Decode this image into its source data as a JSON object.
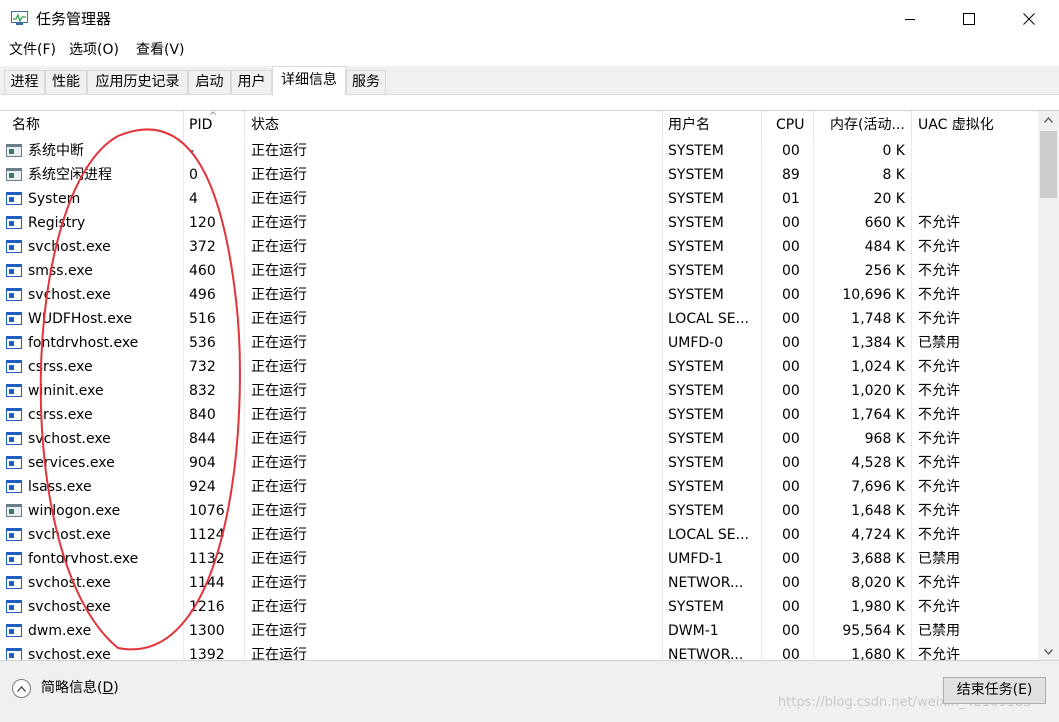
{
  "window": {
    "title": "任务管理器"
  },
  "menu": [
    "文件(F)",
    "选项(O)",
    "查看(V)"
  ],
  "tabs": [
    {
      "label": "进程",
      "active": false
    },
    {
      "label": "性能",
      "active": false
    },
    {
      "label": "应用历史记录",
      "active": false
    },
    {
      "label": "启动",
      "active": false
    },
    {
      "label": "用户",
      "active": false
    },
    {
      "label": "详细信息",
      "active": true
    },
    {
      "label": "服务",
      "active": false
    }
  ],
  "table": {
    "columns": [
      "名称",
      "PID",
      "状态",
      "用户名",
      "CPU",
      "内存(活动...",
      "UAC 虚拟化"
    ],
    "sort_column": "PID",
    "rows": [
      {
        "icon": "system-interrupt-icon",
        "name": "系统中断",
        "pid": "-",
        "status": "正在运行",
        "user": "SYSTEM",
        "cpu": "00",
        "mem": "0 K",
        "uac": ""
      },
      {
        "icon": "system-idle-icon",
        "name": "系统空闲进程",
        "pid": "0",
        "status": "正在运行",
        "user": "SYSTEM",
        "cpu": "89",
        "mem": "8 K",
        "uac": ""
      },
      {
        "icon": "process-icon",
        "name": "System",
        "pid": "4",
        "status": "正在运行",
        "user": "SYSTEM",
        "cpu": "01",
        "mem": "20 K",
        "uac": ""
      },
      {
        "icon": "process-icon",
        "name": "Registry",
        "pid": "120",
        "status": "正在运行",
        "user": "SYSTEM",
        "cpu": "00",
        "mem": "660 K",
        "uac": "不允许"
      },
      {
        "icon": "process-icon",
        "name": "svchost.exe",
        "pid": "372",
        "status": "正在运行",
        "user": "SYSTEM",
        "cpu": "00",
        "mem": "484 K",
        "uac": "不允许"
      },
      {
        "icon": "process-icon",
        "name": "smss.exe",
        "pid": "460",
        "status": "正在运行",
        "user": "SYSTEM",
        "cpu": "00",
        "mem": "256 K",
        "uac": "不允许"
      },
      {
        "icon": "process-icon",
        "name": "svchost.exe",
        "pid": "496",
        "status": "正在运行",
        "user": "SYSTEM",
        "cpu": "00",
        "mem": "10,696 K",
        "uac": "不允许"
      },
      {
        "icon": "process-icon",
        "name": "WUDFHost.exe",
        "pid": "516",
        "status": "正在运行",
        "user": "LOCAL SE...",
        "cpu": "00",
        "mem": "1,748 K",
        "uac": "不允许"
      },
      {
        "icon": "process-icon",
        "name": "fontdrvhost.exe",
        "pid": "536",
        "status": "正在运行",
        "user": "UMFD-0",
        "cpu": "00",
        "mem": "1,384 K",
        "uac": "已禁用"
      },
      {
        "icon": "process-icon",
        "name": "csrss.exe",
        "pid": "732",
        "status": "正在运行",
        "user": "SYSTEM",
        "cpu": "00",
        "mem": "1,024 K",
        "uac": "不允许"
      },
      {
        "icon": "process-icon",
        "name": "wininit.exe",
        "pid": "832",
        "status": "正在运行",
        "user": "SYSTEM",
        "cpu": "00",
        "mem": "1,020 K",
        "uac": "不允许"
      },
      {
        "icon": "process-icon",
        "name": "csrss.exe",
        "pid": "840",
        "status": "正在运行",
        "user": "SYSTEM",
        "cpu": "00",
        "mem": "1,764 K",
        "uac": "不允许"
      },
      {
        "icon": "process-icon",
        "name": "svchost.exe",
        "pid": "844",
        "status": "正在运行",
        "user": "SYSTEM",
        "cpu": "00",
        "mem": "968 K",
        "uac": "不允许"
      },
      {
        "icon": "process-icon",
        "name": "services.exe",
        "pid": "904",
        "status": "正在运行",
        "user": "SYSTEM",
        "cpu": "00",
        "mem": "4,528 K",
        "uac": "不允许"
      },
      {
        "icon": "process-icon",
        "name": "lsass.exe",
        "pid": "924",
        "status": "正在运行",
        "user": "SYSTEM",
        "cpu": "00",
        "mem": "7,696 K",
        "uac": "不允许"
      },
      {
        "icon": "winlogon-icon",
        "name": "winlogon.exe",
        "pid": "1076",
        "status": "正在运行",
        "user": "SYSTEM",
        "cpu": "00",
        "mem": "1,648 K",
        "uac": "不允许"
      },
      {
        "icon": "process-icon",
        "name": "svchost.exe",
        "pid": "1124",
        "status": "正在运行",
        "user": "LOCAL SE...",
        "cpu": "00",
        "mem": "4,724 K",
        "uac": "不允许"
      },
      {
        "icon": "process-icon",
        "name": "fontdrvhost.exe",
        "pid": "1132",
        "status": "正在运行",
        "user": "UMFD-1",
        "cpu": "00",
        "mem": "3,688 K",
        "uac": "已禁用"
      },
      {
        "icon": "process-icon",
        "name": "svchost.exe",
        "pid": "1144",
        "status": "正在运行",
        "user": "NETWOR...",
        "cpu": "00",
        "mem": "8,020 K",
        "uac": "不允许"
      },
      {
        "icon": "process-icon",
        "name": "svchost.exe",
        "pid": "1216",
        "status": "正在运行",
        "user": "SYSTEM",
        "cpu": "00",
        "mem": "1,980 K",
        "uac": "不允许"
      },
      {
        "icon": "process-icon",
        "name": "dwm.exe",
        "pid": "1300",
        "status": "正在运行",
        "user": "DWM-1",
        "cpu": "00",
        "mem": "95,564 K",
        "uac": "已禁用"
      },
      {
        "icon": "process-icon",
        "name": "svchost.exe",
        "pid": "1392",
        "status": "正在运行",
        "user": "NETWOR...",
        "cpu": "00",
        "mem": "1,680 K",
        "uac": "不允许"
      }
    ]
  },
  "footer": {
    "fewer_details": "简略信息",
    "fewer_details_key": "D",
    "end_task": "结束任务(E)",
    "watermark": "https://blog.csdn.net/weixin_42109183"
  },
  "colors": {
    "annotation": "#e0353a",
    "icon_blue": "#1f5fbf"
  }
}
